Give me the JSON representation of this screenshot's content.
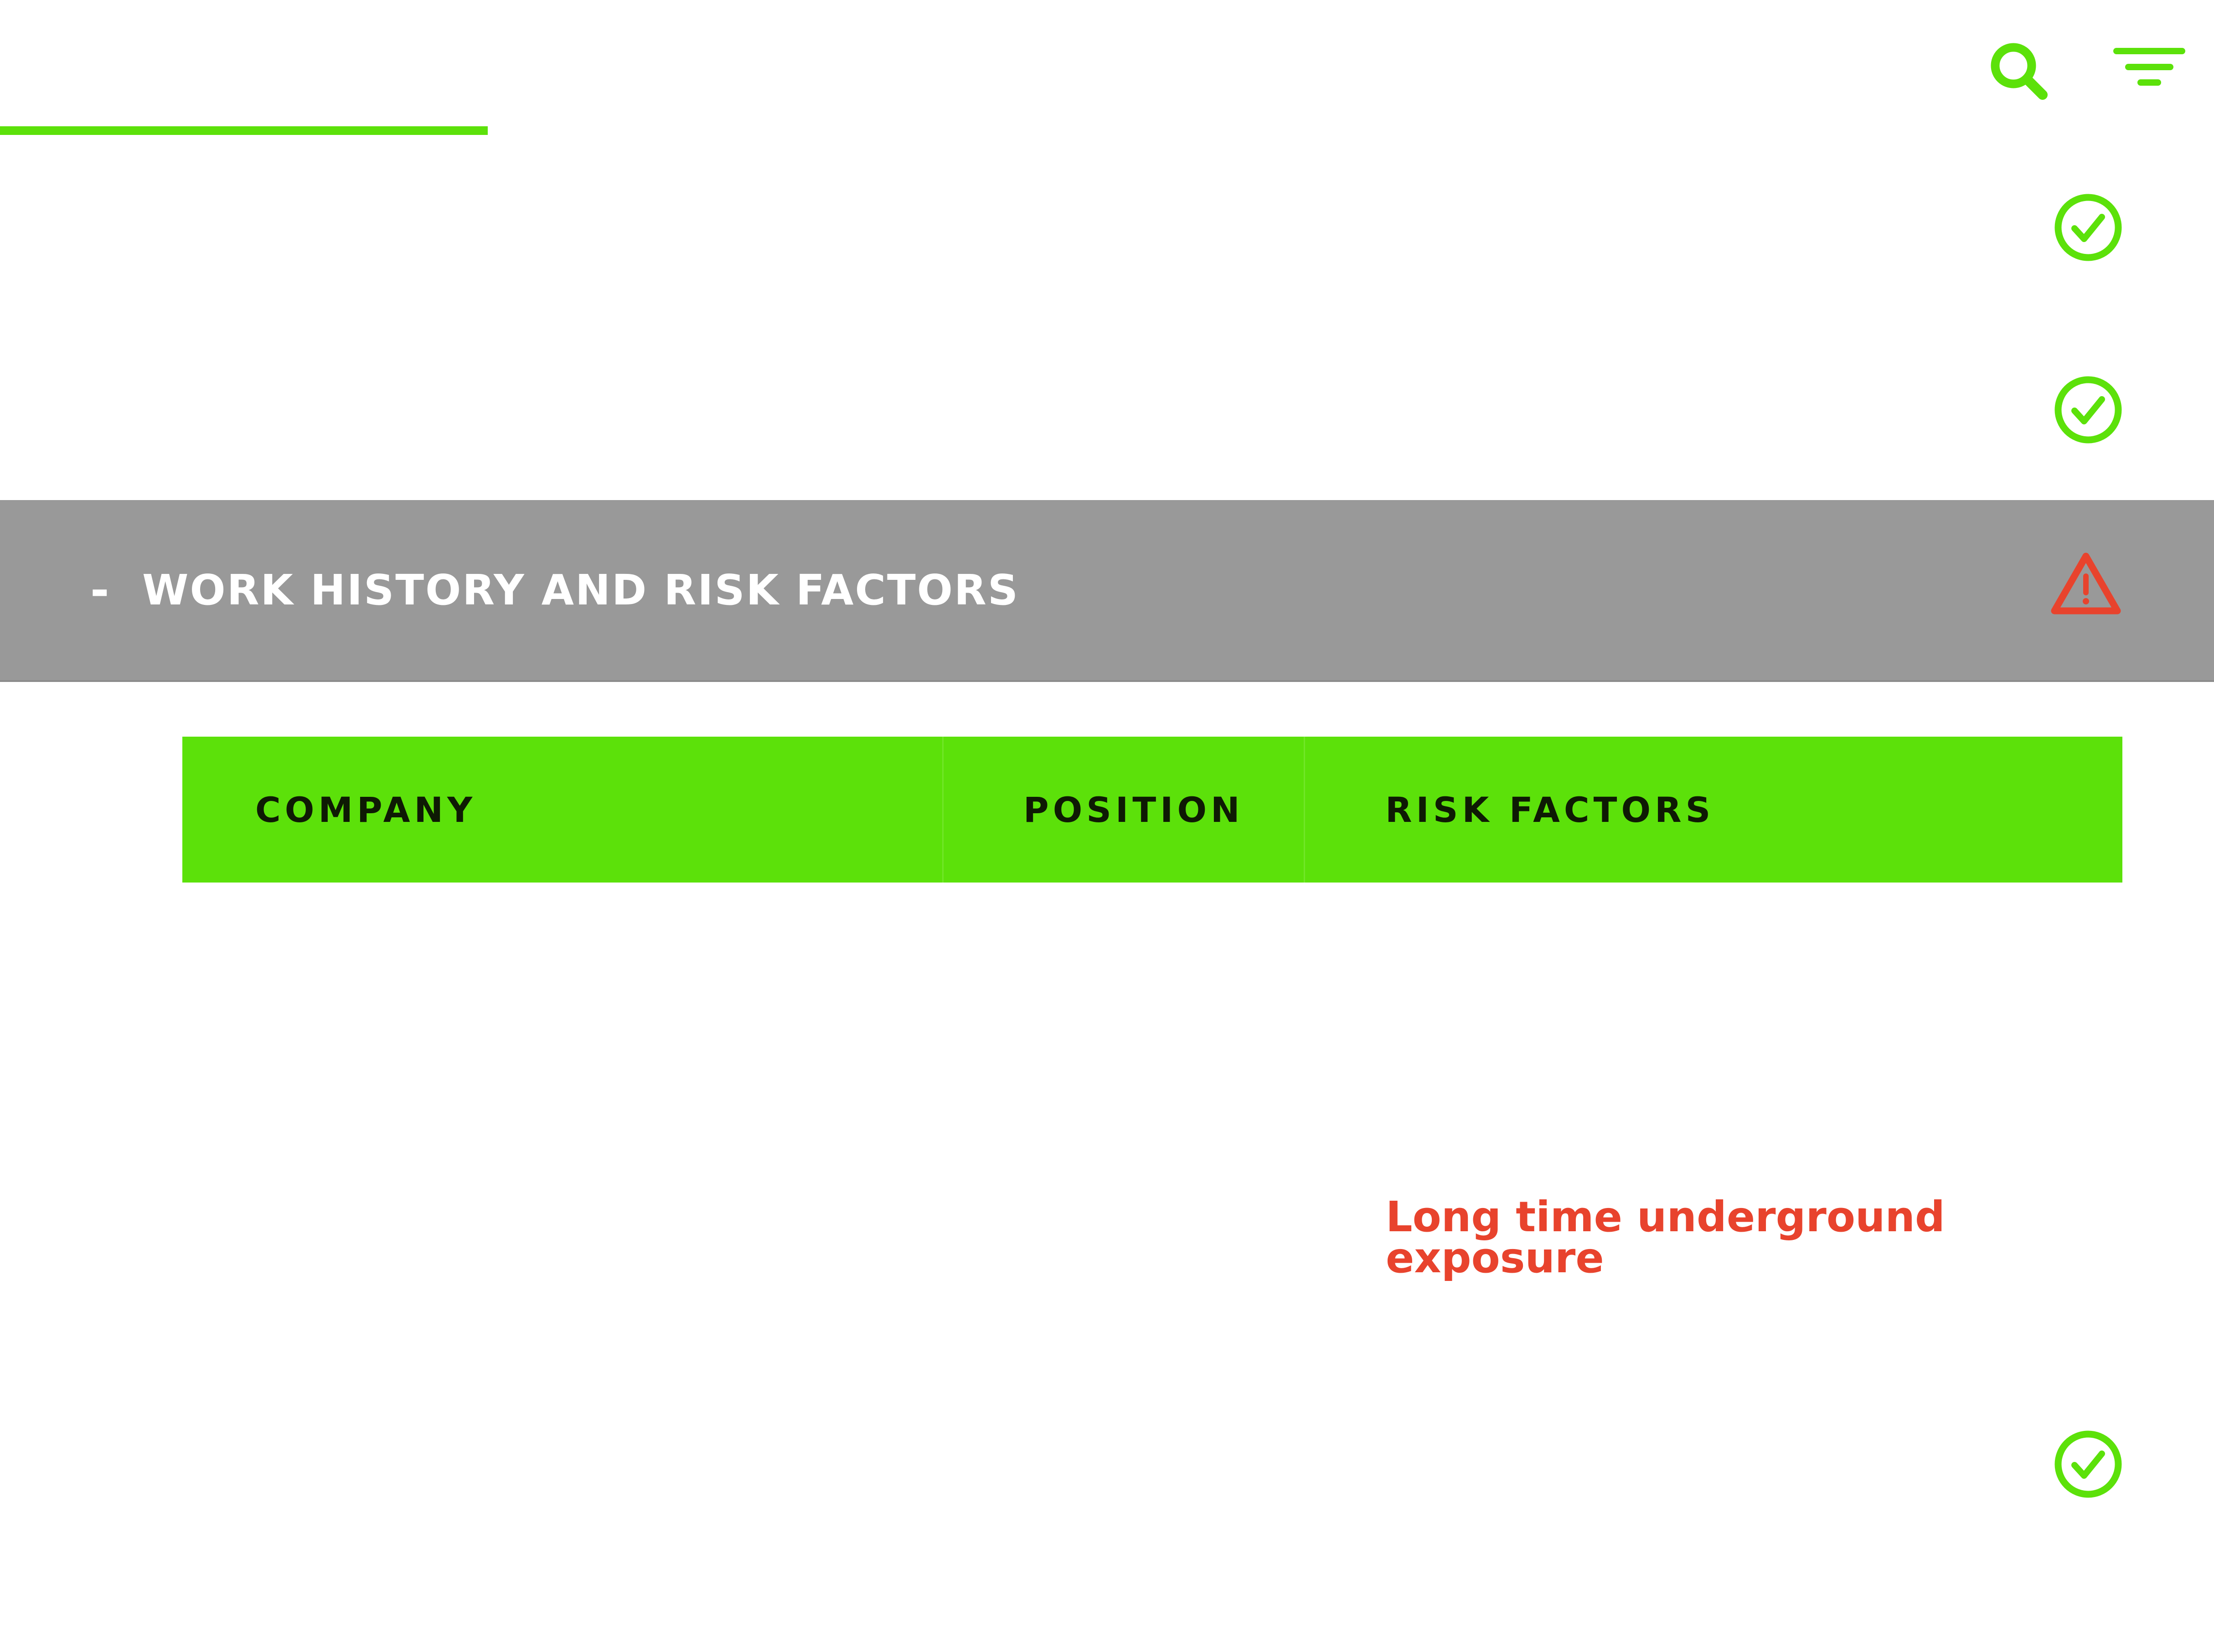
{
  "header": {
    "search_icon": "search-icon",
    "filter_icon": "filter-icon"
  },
  "status_icons": {
    "row1": "check-circle-icon",
    "row2": "check-circle-icon"
  },
  "section": {
    "toggle": "-",
    "title": "WORK HISTORY AND RISK FACTORS",
    "status_icon": "warning-triangle-icon"
  },
  "table": {
    "columns": [
      "COMPANY",
      "POSITION",
      "RISK FACTORS"
    ],
    "rows": [
      {
        "company": "",
        "position": "",
        "risk_factors": "Long time underground exposure",
        "status_icon": "check-circle-icon"
      }
    ]
  },
  "colors": {
    "accent_green": "#5ce10a",
    "section_bar_gray": "#999999",
    "alert_red": "#e8432d",
    "header_text": "#0e1a04"
  }
}
